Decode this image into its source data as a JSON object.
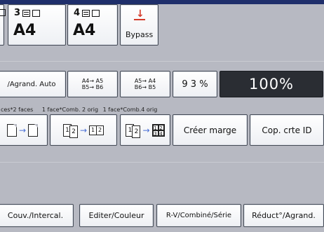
{
  "paper": {
    "tray3": {
      "number": "3",
      "size": "A4"
    },
    "tray4": {
      "number": "4",
      "size": "A4"
    },
    "bypass": {
      "label": "Bypass",
      "arrow": "↓"
    }
  },
  "zoom": {
    "auto": "/Agrand. Auto",
    "a4a5_top": "A4→ A5",
    "a4a5_bottom": "B5→ B6",
    "a5a4_top": "A5→ A4",
    "a5a4_bottom": "B6→ B5",
    "percent93": "9 3 %",
    "percent100": "100%"
  },
  "duplex": {
    "label1": "ces*2 faces",
    "label2": "1 face*Comb. 2 orig",
    "label3": "1 face*Comb.4 orig",
    "creer_marge": "Créer marge",
    "cop_crte_id": "Cop. crte ID",
    "page1": "1",
    "page2": "2",
    "page3": "3",
    "page4": "4"
  },
  "bottom": {
    "couv": "Couv./Intercal.",
    "editer": "Editer/Couleur",
    "rv": "R-V/Combiné/Série",
    "reduct": "Réduct°/Agrand."
  },
  "colors": {
    "accent": "#4a6fd6",
    "bypass_arrow": "#d43a2a",
    "selected": "#2a2d33"
  }
}
